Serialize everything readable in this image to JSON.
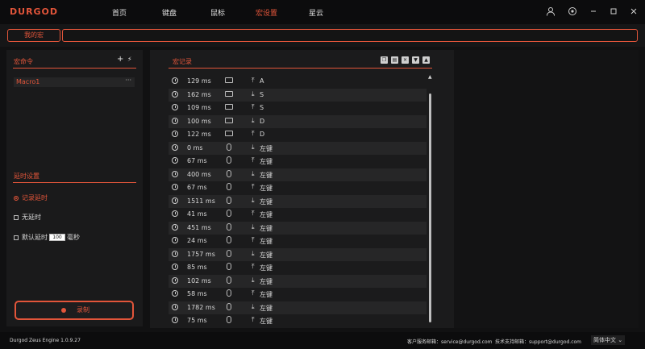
{
  "app": {
    "logo": "DURGOD",
    "nav": [
      "首页",
      "键盘",
      "鼠标",
      "宏设置",
      "星云"
    ],
    "active_nav": "宏设置"
  },
  "macro_bar": {
    "my_macro_label": "我的宏",
    "macro_name_value": ""
  },
  "left": {
    "commands_title": "宏命令",
    "add_icon": "plus-icon",
    "import_icon": "import-icon",
    "macros": [
      {
        "name": "Macro1",
        "menu": "···"
      }
    ],
    "delay_title": "延时设置",
    "options": {
      "record_delay": "记录延时",
      "no_delay": "无延时",
      "default_delay": "默认延时",
      "default_delay_value": "100",
      "default_delay_unit": "毫秒"
    },
    "record_button": "录制"
  },
  "record": {
    "title": "宏记录",
    "toolbar_icons": [
      "copy-icon",
      "paste-icon",
      "delete-icon",
      "move-down-icon",
      "move-up-icon"
    ],
    "rows": [
      {
        "delay": "129 ms",
        "device": "keyboard",
        "dir": "up",
        "key": "A"
      },
      {
        "delay": "162 ms",
        "device": "keyboard",
        "dir": "down",
        "key": "S"
      },
      {
        "delay": "109 ms",
        "device": "keyboard",
        "dir": "up",
        "key": "S"
      },
      {
        "delay": "100 ms",
        "device": "keyboard",
        "dir": "down",
        "key": "D"
      },
      {
        "delay": "122 ms",
        "device": "keyboard",
        "dir": "up",
        "key": "D"
      },
      {
        "delay": "0 ms",
        "device": "mouse",
        "dir": "down",
        "key": "左键"
      },
      {
        "delay": "67 ms",
        "device": "mouse",
        "dir": "up",
        "key": "左键"
      },
      {
        "delay": "400 ms",
        "device": "mouse",
        "dir": "down",
        "key": "左键"
      },
      {
        "delay": "67 ms",
        "device": "mouse",
        "dir": "up",
        "key": "左键"
      },
      {
        "delay": "1511 ms",
        "device": "mouse",
        "dir": "down",
        "key": "左键"
      },
      {
        "delay": "41 ms",
        "device": "mouse",
        "dir": "up",
        "key": "左键"
      },
      {
        "delay": "451 ms",
        "device": "mouse",
        "dir": "down",
        "key": "左键"
      },
      {
        "delay": "24 ms",
        "device": "mouse",
        "dir": "up",
        "key": "左键"
      },
      {
        "delay": "1757 ms",
        "device": "mouse",
        "dir": "down",
        "key": "左键"
      },
      {
        "delay": "85 ms",
        "device": "mouse",
        "dir": "up",
        "key": "左键"
      },
      {
        "delay": "102 ms",
        "device": "mouse",
        "dir": "down",
        "key": "左键"
      },
      {
        "delay": "58 ms",
        "device": "mouse",
        "dir": "up",
        "key": "左键"
      },
      {
        "delay": "1782 ms",
        "device": "mouse",
        "dir": "down",
        "key": "左键"
      },
      {
        "delay": "75 ms",
        "device": "mouse",
        "dir": "up",
        "key": "左键"
      }
    ]
  },
  "footer": {
    "engine": "Durgod Zeus Engine 1.0.9.27",
    "service": "客户服务邮箱：service@durgod.com",
    "support": "技术支持邮箱：support@durgod.com",
    "language": "简体中文 ⌄"
  },
  "colors": {
    "accent": "#e2553a",
    "background": "#111112"
  }
}
